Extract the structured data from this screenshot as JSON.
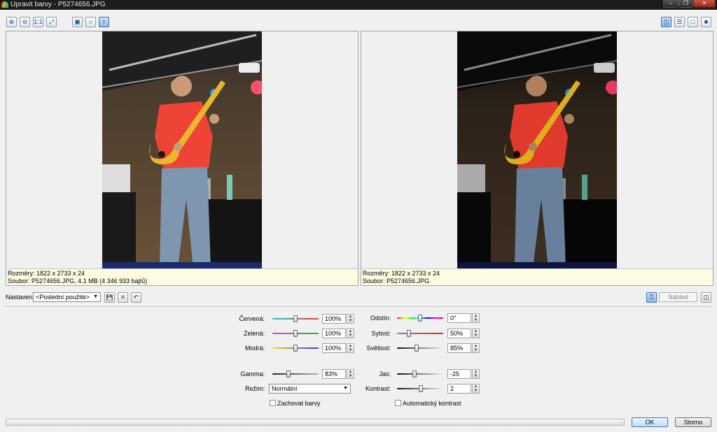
{
  "window": {
    "title": "Upravit barvy - P5274656.JPG",
    "min": "–",
    "max": "❐",
    "close": "✕"
  },
  "toolbar": {
    "left": [
      {
        "name": "zoom-in-button",
        "glyph": "⊕"
      },
      {
        "name": "zoom-out-button",
        "glyph": "⊖"
      },
      {
        "name": "actual-size-button",
        "glyph": "1:1"
      },
      {
        "name": "fit-window-button",
        "glyph": "⤢"
      },
      {
        "name": "compare-image-button",
        "glyph": "▣"
      },
      {
        "name": "highlight-button",
        "glyph": "☼"
      },
      {
        "name": "info-button",
        "glyph": "i"
      }
    ],
    "right": [
      {
        "name": "split-vertical-button",
        "glyph": "◫"
      },
      {
        "name": "split-horizontal-button",
        "glyph": "☰"
      },
      {
        "name": "single-view-button",
        "glyph": "□"
      },
      {
        "name": "original-view-button",
        "glyph": "■"
      }
    ]
  },
  "original": {
    "dims": "Rozměry: 1822 x 2733 x 24",
    "file": "Soubor: P5274656.JPG, 4.1 MB (4 346 933 bajtů)"
  },
  "preview": {
    "dims": "Rozměry: 1822 x 2733 x 24",
    "file": "Soubor: P5274656.JPG"
  },
  "settings": {
    "label": "Nastavení:",
    "value": "<Poslední použité>",
    "save_glyph": "💾",
    "delete_glyph": "✖",
    "reset_glyph": "↶",
    "lock_glyph": "⚿",
    "preview_label": "Náhled",
    "layout_glyph": "◫"
  },
  "adjustments": {
    "left": [
      {
        "key": "red",
        "label": "Červená:",
        "value": "100%",
        "pos": 0.5,
        "track": "linear-gradient(90deg,#1ec8d8,#ee3333)"
      },
      {
        "key": "green",
        "label": "Zelená:",
        "value": "100%",
        "pos": 0.5,
        "track": "linear-gradient(90deg,#e040e0,#22bb22)"
      },
      {
        "key": "blue",
        "label": "Modrá:",
        "value": "100%",
        "pos": 0.5,
        "track": "linear-gradient(90deg,#eedd11,#3333ee)"
      },
      {
        "key": "gamma",
        "label": "Gamma:",
        "value": "83%",
        "pos": 0.35,
        "track": "linear-gradient(90deg,#222,#bbb)"
      }
    ],
    "right": [
      {
        "key": "hue",
        "label": "Odstín:",
        "value": "0°",
        "pos": 0.5,
        "track": "linear-gradient(90deg,#f00,#ff0,#0f0,#0ff,#00f,#f0f,#f00)"
      },
      {
        "key": "saturation",
        "label": "Sytost:",
        "value": "50%",
        "pos": 0.25,
        "track": "linear-gradient(90deg,#888,#e22)"
      },
      {
        "key": "lightness",
        "label": "Světlost:",
        "value": "85%",
        "pos": 0.43,
        "track": "linear-gradient(90deg,#111,#eee)"
      },
      {
        "key": "brightness",
        "label": "Jas:",
        "value": "-25",
        "pos": 0.38,
        "track": "linear-gradient(90deg,#111,#eee)"
      },
      {
        "key": "contrast",
        "label": "Kontrast:",
        "value": "2",
        "pos": 0.52,
        "track": "linear-gradient(90deg,#111,#eee)"
      }
    ]
  },
  "mode": {
    "label": "Režim:",
    "value": "Normální"
  },
  "checkboxes": {
    "preserve": "Zachovat barvy",
    "autocontrast": "Automatický kontrast"
  },
  "buttons": {
    "ok": "OK",
    "cancel": "Storno"
  },
  "spin": {
    "up": "▲",
    "down": "▼"
  }
}
